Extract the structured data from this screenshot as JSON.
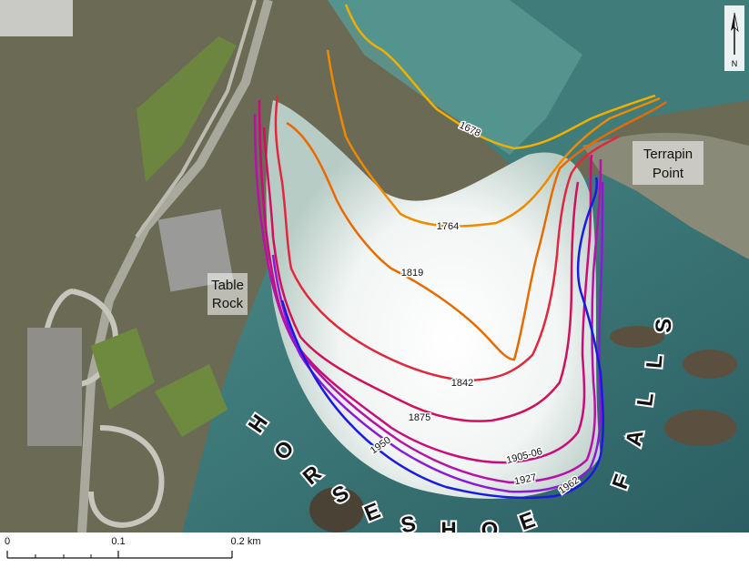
{
  "map": {
    "places": {
      "table_rock_line1": "Table",
      "table_rock_line2": "Rock",
      "terrapin_line1": "Terrapin",
      "terrapin_line2": "Point"
    },
    "falls_letters": [
      "H",
      "O",
      "R",
      "S",
      "E",
      "S",
      "H",
      "O",
      "E",
      "F",
      "A",
      "L",
      "L",
      "S"
    ],
    "north_arrow": "N",
    "crestlines": [
      {
        "year": "1678",
        "color": "#f0b000"
      },
      {
        "year": "1764",
        "color": "#f08a00"
      },
      {
        "year": "1819",
        "color": "#e86a00"
      },
      {
        "year": "1842",
        "color": "#e0283c"
      },
      {
        "year": "1875",
        "color": "#d0105a"
      },
      {
        "year": "1905-06",
        "color": "#cc0b7a"
      },
      {
        "year": "1927",
        "color": "#b612a8"
      },
      {
        "year": "1950",
        "color": "#8a1ad8"
      },
      {
        "year": "1962",
        "color": "#1a1ae0"
      }
    ]
  },
  "scale": {
    "ticks": [
      "0",
      "0.1",
      "0.2 km"
    ]
  }
}
